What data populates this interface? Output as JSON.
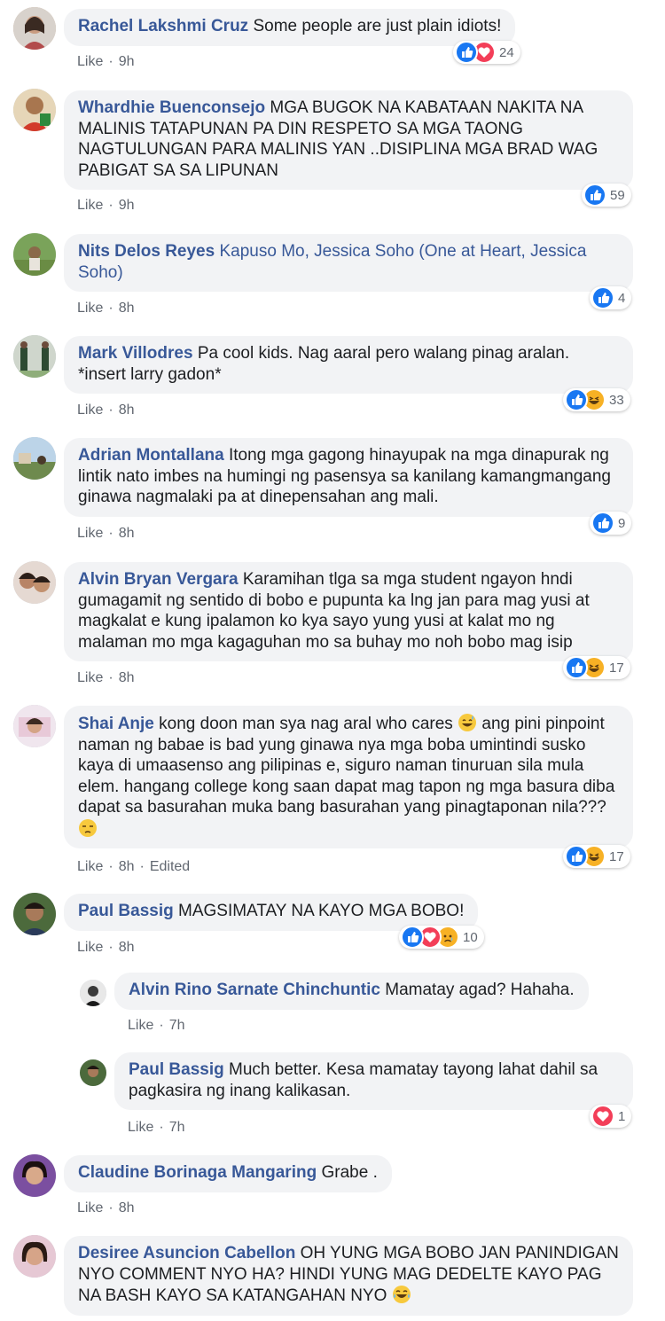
{
  "colors": {
    "author": "#385898",
    "bubble": "#f2f3f5",
    "meta": "#616770",
    "like_blue": "#1877f2",
    "love_red": "#f33e58",
    "emoji_yellow": "#f7b125"
  },
  "comments": [
    {
      "author": "Rachel Lakshmi Cruz",
      "text": "Some people are just plain idiots!",
      "like": "Like",
      "time": "9h",
      "reaction_icons": [
        "like-icon",
        "love-icon"
      ],
      "reaction_count": "24"
    },
    {
      "author": "Whardhie Buenconsejo",
      "text": "MGA BUGOK NA KABATAAN NAKITA NA MALINIS TATAPUNAN PA DIN RESPETO SA MGA TAONG NAGTULUNGAN PARA MALINIS YAN ..DISIPLINA MGA BRAD WAG PABIGAT SA SA LIPUNAN",
      "like": "Like",
      "time": "9h",
      "reaction_icons": [
        "like-icon"
      ],
      "reaction_count": "59"
    },
    {
      "author": "Nits Delos Reyes",
      "text": "Kapuso Mo, Jessica Soho (One at Heart, Jessica Soho)",
      "like": "Like",
      "time": "8h",
      "reaction_icons": [
        "like-icon"
      ],
      "reaction_count": "4"
    },
    {
      "author": "Mark Villodres",
      "text": "Pa cool kids. Nag aaral pero walang pinag aralan. *insert larry gadon*",
      "like": "Like",
      "time": "8h",
      "reaction_icons": [
        "like-icon",
        "haha-icon"
      ],
      "reaction_count": "33"
    },
    {
      "author": "Adrian Montallana",
      "text": "Itong mga gagong hinayupak na mga dinapurak ng lintik nato imbes na humingi ng pasensya sa kanilang kamangmangang ginawa nagmalaki pa at dinepensahan ang mali.",
      "like": "Like",
      "time": "8h",
      "reaction_icons": [
        "like-icon"
      ],
      "reaction_count": "9"
    },
    {
      "author": "Alvin Bryan Vergara",
      "text": "Karamihan tlga sa mga student ngayon hndi gumagamit ng sentido di bobo e pupunta ka lng jan para mag yusi at magkalat e kung ipalamon ko kya sayo yung yusi at kalat mo ng malaman mo mga kagaguhan mo sa buhay mo noh bobo mag isip",
      "like": "Like",
      "time": "8h",
      "reaction_icons": [
        "like-icon",
        "haha-icon"
      ],
      "reaction_count": "17"
    },
    {
      "author": "Shai Anje",
      "text_parts": [
        "kong doon man sya nag aral who cares ",
        " ang pini pinpoint naman ng babae is bad yung ginawa nya mga boba umintindi susko kaya di umaasenso ang pilipinas e, siguro naman tinuruan sila mula elem. hangang college kong saan dapat mag tapon ng mga basura diba dapat sa basurahan muka bang basurahan yang pinagtaponan nila??? "
      ],
      "inline_emoji": [
        "grinning-sweat-emoji",
        "unamused-emoji"
      ],
      "like": "Like",
      "time": "8h",
      "edited": "Edited",
      "reaction_icons": [
        "like-icon",
        "haha-icon"
      ],
      "reaction_count": "17"
    },
    {
      "author": "Paul Bassig",
      "text": "MAGSIMATAY NA KAYO MGA BOBO!",
      "like": "Like",
      "time": "8h",
      "reaction_icons": [
        "like-icon",
        "love-icon",
        "sad-icon"
      ],
      "reaction_count": "10"
    },
    {
      "author": "Alvin Rino Sarnate Chinchuntic",
      "text": "Mamatay agad? Hahaha.",
      "like": "Like",
      "time": "7h",
      "reply": true
    },
    {
      "author": "Paul Bassig",
      "text": "Much better. Kesa mamatay tayong lahat dahil sa pagkasira ng inang kalikasan.",
      "like": "Like",
      "time": "7h",
      "reply": true,
      "reaction_icons": [
        "love-icon"
      ],
      "reaction_count": "1"
    },
    {
      "author": "Claudine Borinaga Mangaring",
      "text": "Grabe .",
      "like": "Like",
      "time": "8h"
    },
    {
      "author": "Desiree Asuncion Cabellon",
      "text_parts": [
        "OH YUNG MGA BOBO JAN PANINDIGAN NYO COMMENT NYO HA? HINDI YUNG MAG DEDELTE KAYO PAG NA BASH KAYO SA KATANGAHAN NYO "
      ],
      "inline_emoji": [
        "tears-of-joy-emoji"
      ]
    }
  ]
}
